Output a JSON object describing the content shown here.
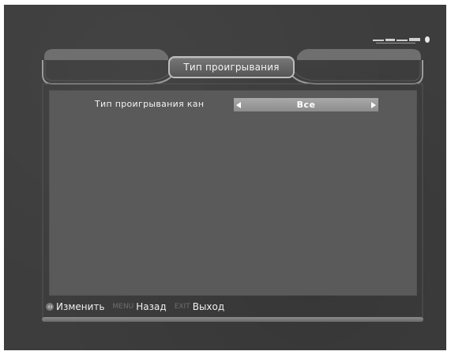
{
  "menu": {
    "title": "Тип проигрывания"
  },
  "setting": {
    "label": "Тип проигрывания кан",
    "value": "Все"
  },
  "footer": {
    "change_label": "Изменить",
    "menu_key": "MENU",
    "back_label": "Назад",
    "exit_key": "EXIT",
    "exit_label": "Выход"
  },
  "colors": {
    "background": "#3d3d3d",
    "panel": "#5a5a5a",
    "selector": "#999999",
    "text": "#f2f2f2"
  },
  "icons": {
    "left_right": "left-right-arrows-icon",
    "prev": "arrow-left-icon",
    "next": "arrow-right-icon"
  }
}
